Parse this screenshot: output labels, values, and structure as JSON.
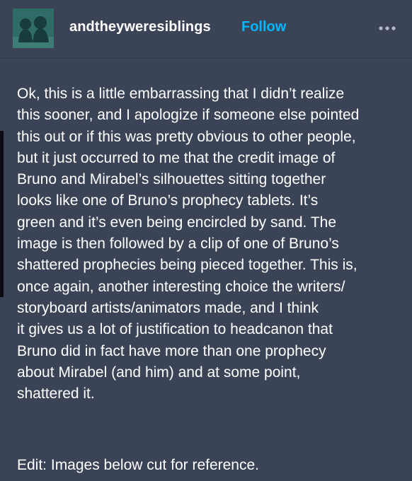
{
  "post": {
    "author": "andtheyweresiblings",
    "follow_label": "Follow",
    "more_icon": "ellipsis-icon",
    "body_lines": [
      "Ok, this is a little embarrassing that I didn’t realize",
      "this sooner, and I apologize if someone else pointed",
      "this out or if this was pretty obvious to other people,",
      "but it just occurred to me that the credit image of",
      "Bruno and Mirabel’s silhouettes  sitting together",
      "looks like one of Bruno’s prophecy tablets. It’s",
      "green and it’s even being encircled by sand. The",
      "image is then followed by a clip of one of Bruno’s",
      "shattered prophecies being pieced together. This is,",
      "once again, another interesting choice the writers/",
      "storyboard artists/animators made, and I think",
      "it gives us a lot of justification to headcanon that",
      "Bruno did in fact have more than one prophecy",
      "about Mirabel (and him) and at some point,",
      "shattered it."
    ],
    "edit_note": "Edit: Images below cut for reference."
  },
  "colors": {
    "background": "#3b4456",
    "text": "#ffffff",
    "follow_accent": "#00b8ff",
    "avatar_bg": "#2f6b67"
  }
}
